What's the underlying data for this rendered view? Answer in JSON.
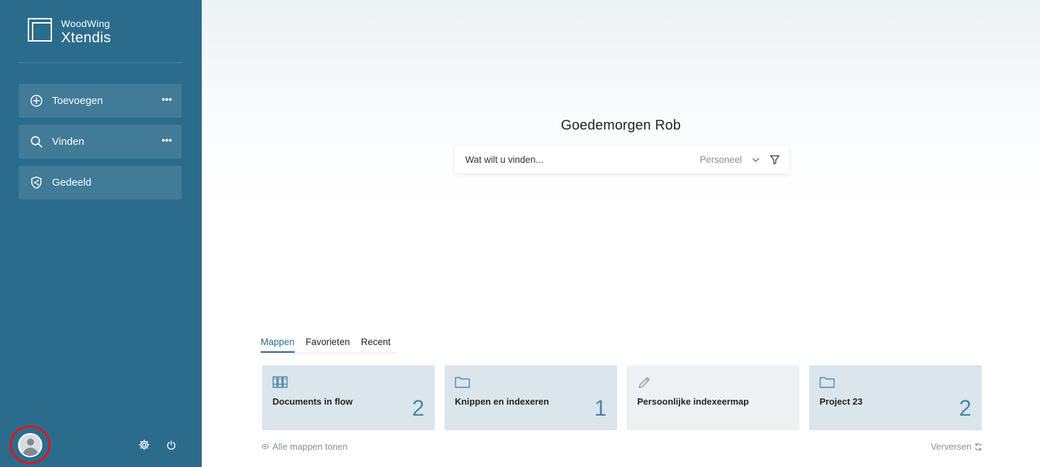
{
  "brand": {
    "line1": "WoodWing",
    "line2": "Xtendis"
  },
  "sidebar": {
    "items": [
      {
        "label": "Toevoegen",
        "icon": "plus-circle-icon",
        "more": "•••"
      },
      {
        "label": "Vinden",
        "icon": "search-icon",
        "more": "•••"
      },
      {
        "label": "Gedeeld",
        "icon": "share-shield-icon"
      }
    ],
    "footer_icons": [
      "user-avatar",
      "gear-icon",
      "power-icon"
    ]
  },
  "main": {
    "greeting": "Goedemorgen Rob",
    "search": {
      "placeholder": "Wat wilt u vinden...",
      "scope": "Personeel"
    },
    "tabs": [
      {
        "label": "Mappen",
        "active": true
      },
      {
        "label": "Favorieten",
        "active": false
      },
      {
        "label": "Recent",
        "active": false
      }
    ],
    "cards": [
      {
        "title": "Documents in flow",
        "count": "2",
        "icon": "binders-icon"
      },
      {
        "title": "Knippen en indexeren",
        "count": "1",
        "icon": "folder-icon"
      },
      {
        "title": "Persoonlijke indexeermap",
        "count": "",
        "icon": "pencil-icon"
      },
      {
        "title": "Project 23",
        "count": "2",
        "icon": "folder-icon"
      }
    ],
    "show_all": "Alle mappen tonen",
    "refresh": "Verversen"
  },
  "colors": {
    "sidebar": "#2b6c8d",
    "card": "#dbe5ec",
    "card_light": "#eef1f4",
    "count": "#4e86a8",
    "highlight_ring": "#e3141b"
  }
}
